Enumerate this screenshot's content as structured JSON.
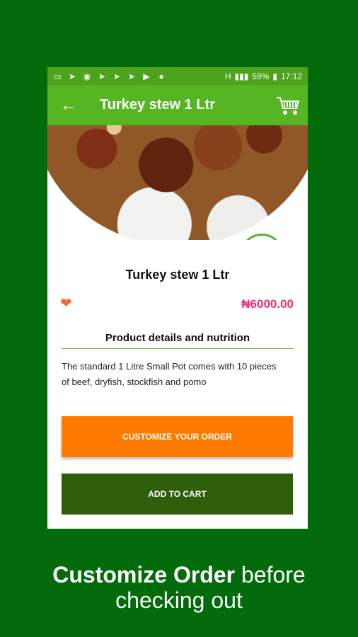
{
  "status_bar": {
    "battery": "59%",
    "time": "17:12",
    "network": "H"
  },
  "app_bar": {
    "title": "Turkey stew 1 Ltr",
    "back_icon": "back-arrow-icon",
    "cart_icon": "shopping-cart-icon"
  },
  "product": {
    "title": "Turkey stew 1 Ltr",
    "price": "₦6000.00",
    "favorite_icon": "heart-icon"
  },
  "details": {
    "heading": "Product details and nutrition",
    "description": "The standard 1 Litre Small Pot comes with 10 pieces of beef, dryfish, stockfish and pomo"
  },
  "buttons": {
    "customize": "CUSTOMIZE YOUR ORDER",
    "add_to_cart": "ADD TO CART"
  },
  "caption": {
    "bold": "Customize Order",
    "rest": " before",
    "line2": "checking out"
  },
  "colors": {
    "background": "#036b0b",
    "app_bar": "#55b522",
    "price": "#ee2e7a",
    "customize_button": "#ff7b00",
    "cart_button": "#2f5f0c"
  }
}
